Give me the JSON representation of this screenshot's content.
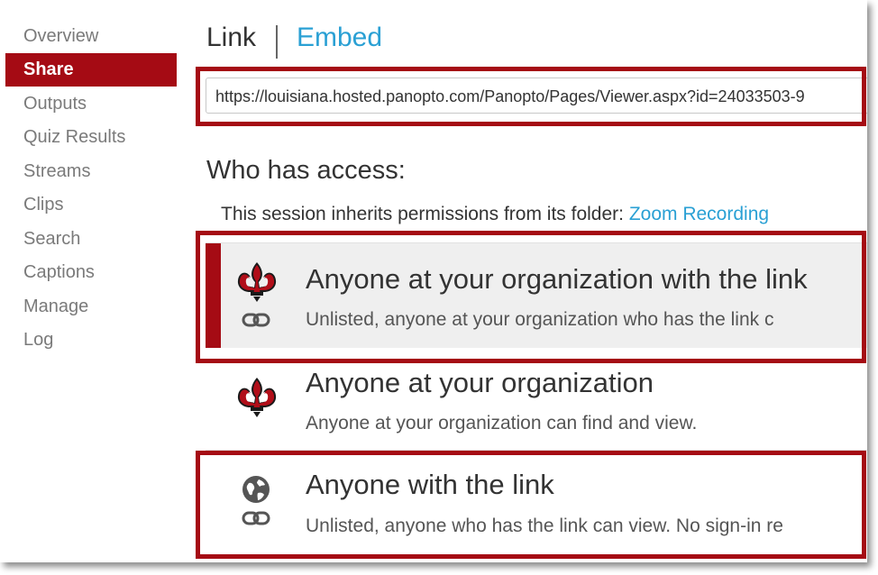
{
  "sidebar": {
    "items": [
      {
        "label": "Overview",
        "active": false
      },
      {
        "label": "Share",
        "active": true
      },
      {
        "label": "Outputs",
        "active": false
      },
      {
        "label": "Quiz Results",
        "active": false
      },
      {
        "label": "Streams",
        "active": false
      },
      {
        "label": "Clips",
        "active": false
      },
      {
        "label": "Search",
        "active": false
      },
      {
        "label": "Captions",
        "active": false
      },
      {
        "label": "Manage",
        "active": false
      },
      {
        "label": "Log",
        "active": false
      }
    ]
  },
  "tabs": {
    "link": "Link",
    "embed": "Embed"
  },
  "url": {
    "value": "https://louisiana.hosted.panopto.com/Panopto/Pages/Viewer.aspx?id=24033503-9"
  },
  "access": {
    "heading": "Who has access:",
    "inherit_text": "This session inherits permissions from its folder: ",
    "inherit_link": "Zoom Recording"
  },
  "options": [
    {
      "title": "Anyone at your organization with the link",
      "description": "Unlisted, anyone at your organization who has the link c",
      "selected": true,
      "icons": [
        "fleur-de-lis-icon",
        "link-icon"
      ]
    },
    {
      "title": "Anyone at your organization",
      "description": "Anyone at your organization can find and view.",
      "selected": false,
      "icons": [
        "fleur-de-lis-icon"
      ]
    },
    {
      "title": "Anyone with the link",
      "description": "Unlisted, anyone who has the link can view. No sign-in re",
      "selected": false,
      "icons": [
        "globe-icon",
        "link-icon"
      ]
    }
  ],
  "colors": {
    "accent": "#a50b14",
    "link": "#2aa0d4",
    "selected_bg": "#efefef",
    "nav_text": "#7a7a7a"
  }
}
